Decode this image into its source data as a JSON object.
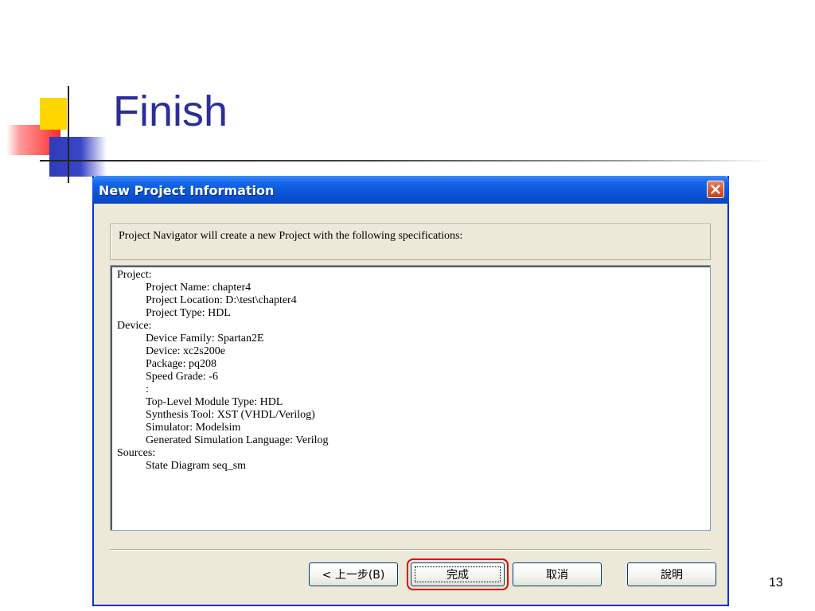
{
  "slide": {
    "title": "Finish",
    "page_number": "13"
  },
  "dialog": {
    "title": "New Project Information",
    "close_icon": "close-icon",
    "info_label": "Project Navigator will create a new Project with the following specifications:",
    "spec_lines": [
      {
        "text": "Project:",
        "indent": false
      },
      {
        "text": "Project Name: chapter4",
        "indent": true
      },
      {
        "text": "Project Location: D:\\test\\chapter4",
        "indent": true
      },
      {
        "text": "Project Type: HDL",
        "indent": true
      },
      {
        "text": "Device:",
        "indent": false
      },
      {
        "text": "Device Family: Spartan2E",
        "indent": true
      },
      {
        "text": "Device: xc2s200e",
        "indent": true
      },
      {
        "text": "Package: pq208",
        "indent": true
      },
      {
        "text": "Speed Grade: -6",
        "indent": true
      },
      {
        "text": ":",
        "indent": true
      },
      {
        "text": "Top-Level Module Type: HDL",
        "indent": true
      },
      {
        "text": "Synthesis Tool: XST (VHDL/Verilog)",
        "indent": true
      },
      {
        "text": "Simulator: Modelsim",
        "indent": true
      },
      {
        "text": "Generated Simulation Language: Verilog",
        "indent": true
      },
      {
        "text": "Sources:",
        "indent": false
      },
      {
        "text": "State Diagram seq_sm",
        "indent": true
      }
    ],
    "buttons": {
      "back": "< 上一步(B)",
      "finish": "完成",
      "cancel": "取消",
      "help": "說明"
    }
  },
  "colors": {
    "title_blue": "#2b2f9a",
    "dialog_face": "#ece9d8",
    "titlebar_blue": "#0a55d8",
    "highlight_red": "#e00000"
  }
}
